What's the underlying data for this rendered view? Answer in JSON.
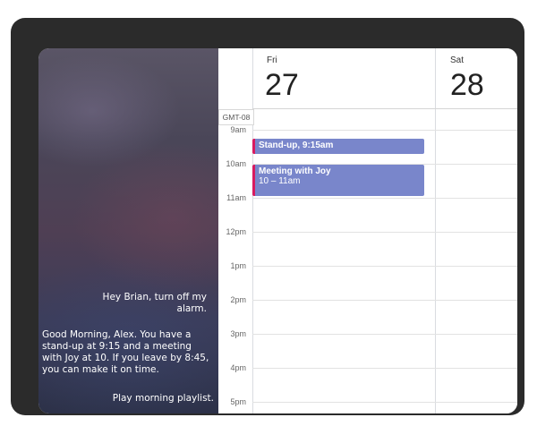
{
  "assistant_panel": {
    "user_command_1": "Hey Brian, turn off my alarm.",
    "assistant_reply": "Good Morning, Alex. You have a stand-up at 9:15 and a meeting with Joy at 10. If you leave by 8:45, you can make it on time.",
    "user_command_2": "Play morning playlist."
  },
  "calendar": {
    "timezone": "GMT-08",
    "days": [
      {
        "name": "Fri",
        "number": "27"
      },
      {
        "name": "Sat",
        "number": "28"
      }
    ],
    "times": [
      "9am",
      "10am",
      "11am",
      "12pm",
      "1pm",
      "2pm",
      "3pm",
      "4pm",
      "5pm"
    ],
    "events": [
      {
        "title": "Stand-up, 9:15am",
        "time": ""
      },
      {
        "title": "Meeting with Joy",
        "time": "10 – 11am"
      }
    ],
    "colors": {
      "event": "#7986cb",
      "event_accent": "#d81b60"
    }
  }
}
